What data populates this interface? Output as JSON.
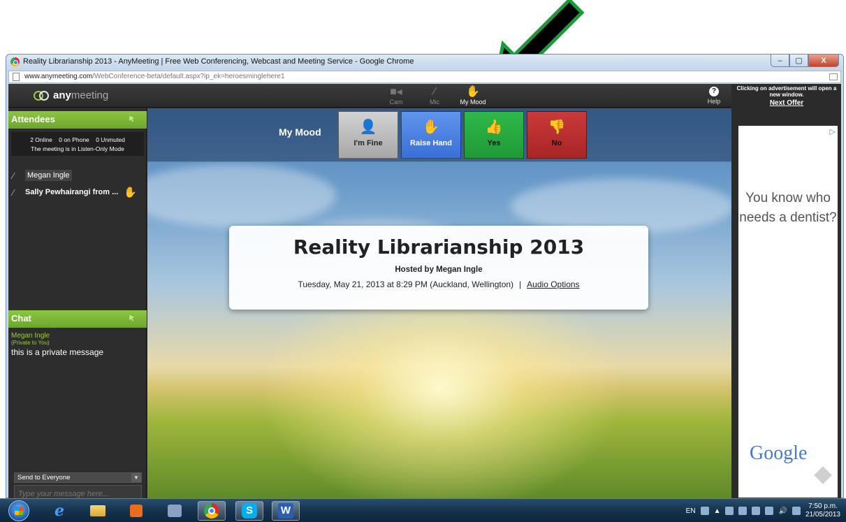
{
  "window": {
    "title": "Reality Librarianship 2013 - AnyMeeting | Free Web Conferencing, Webcast and Meeting Service - Google Chrome",
    "controls": {
      "minimize": "–",
      "maximize": "▢",
      "close": "X"
    }
  },
  "address_bar": {
    "host": "www.anymeeting.com",
    "path": "/WebConference-beta/default.aspx?ip_ek=heroesminglehere1"
  },
  "app": {
    "logo_any": "any",
    "logo_meeting": "meeting",
    "toolbar": [
      {
        "label": "Cam",
        "icon": "camera-icon",
        "active": false
      },
      {
        "label": "Mic",
        "icon": "mic-muted-icon",
        "active": false
      },
      {
        "label": "My Mood",
        "icon": "hand-icon",
        "active": true
      }
    ],
    "help_label": "Help"
  },
  "attendees": {
    "title": "Attendees",
    "status_line1": "2 Online    0 on Phone    0 Unmuted",
    "status_line2": "The meeting is in Listen-Only Mode",
    "list": [
      {
        "name": "Megan Ingle",
        "hand_raised": false
      },
      {
        "name": "Sally Pewhairangi from ...",
        "hand_raised": true
      }
    ]
  },
  "chat": {
    "title": "Chat",
    "messages": [
      {
        "from": "Megan Ingle",
        "privacy": "(Private to You)",
        "text": "this is a private message"
      }
    ],
    "send_to": "Send to Everyone",
    "input_placeholder": "Type your message here..."
  },
  "mood": {
    "label": "My Mood",
    "options": [
      {
        "label": "I'm Fine",
        "icon": "person-icon",
        "color": "#bdbdbd"
      },
      {
        "label": "Raise Hand",
        "icon": "hand-icon",
        "color": "#4a82e2"
      },
      {
        "label": "Yes",
        "icon": "thumbs-up-icon",
        "color": "#27a93f"
      },
      {
        "label": "No",
        "icon": "thumbs-down-icon",
        "color": "#b82f2f"
      }
    ]
  },
  "meeting": {
    "title": "Reality Librarianship 2013",
    "host": "Hosted by Megan Ingle",
    "when": "Tuesday, May 21, 2013 at 8:29 PM (Auckland, Wellington)",
    "separator": "|",
    "audio_options": "Audio Options"
  },
  "ad": {
    "notice": "Clicking on advertisement will open a new window.",
    "next_offer": "Next Offer",
    "text": "You know who needs a dentist?",
    "advertiser": "Google"
  },
  "taskbar": {
    "language": "EN",
    "time": "7:50 p.m.",
    "date": "21/05/2013"
  },
  "colors": {
    "accent_green": "#8cc63f",
    "annotation_arrow_fill": "#000000",
    "annotation_arrow_outline": "#1a9a3a"
  }
}
